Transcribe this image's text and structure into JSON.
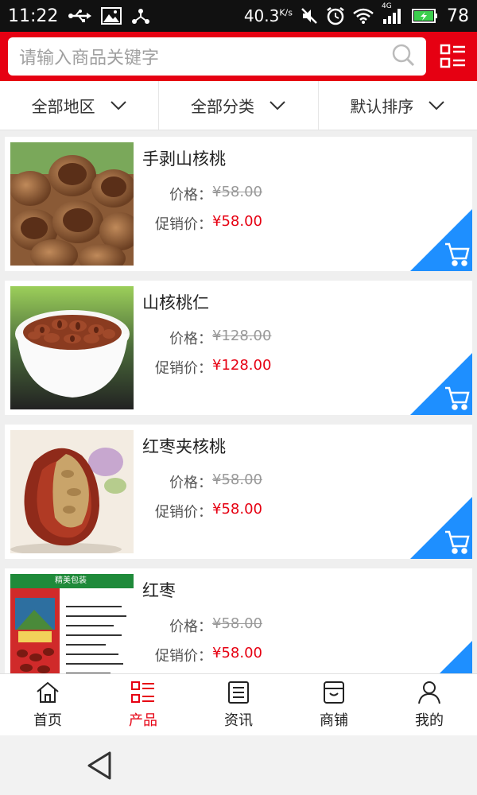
{
  "status_bar": {
    "time": "11:22",
    "network_speed": "40.3",
    "network_unit": "K/s",
    "signal_label": "4G",
    "battery": "78"
  },
  "header": {
    "search_placeholder": "请输入商品关键字"
  },
  "filters": [
    {
      "label": "全部地区"
    },
    {
      "label": "全部分类"
    },
    {
      "label": "默认排序"
    }
  ],
  "products": [
    {
      "name": "手剥山核桃",
      "price_label": "价格：",
      "price": "¥58.00",
      "promo_label": "促销价：",
      "promo_price": "¥58.00"
    },
    {
      "name": "山核桃仁",
      "price_label": "价格：",
      "price": "¥128.00",
      "promo_label": "促销价：",
      "promo_price": "¥128.00"
    },
    {
      "name": "红枣夹核桃",
      "price_label": "价格：",
      "price": "¥58.00",
      "promo_label": "促销价：",
      "promo_price": "¥58.00"
    },
    {
      "name": "红枣",
      "price_label": "价格：",
      "price": "¥58.00",
      "promo_label": "促销价：",
      "promo_price": "¥58.00"
    }
  ],
  "product4_image_text": "精美包装",
  "bottom_nav": [
    {
      "label": "首页",
      "icon": "home-icon"
    },
    {
      "label": "产品",
      "icon": "list-icon"
    },
    {
      "label": "资讯",
      "icon": "news-icon"
    },
    {
      "label": "商铺",
      "icon": "shop-icon"
    },
    {
      "label": "我的",
      "icon": "user-icon"
    }
  ],
  "colors": {
    "brand_red": "#e60012",
    "cart_blue": "#1e8fff",
    "status_bar": "#111111"
  }
}
